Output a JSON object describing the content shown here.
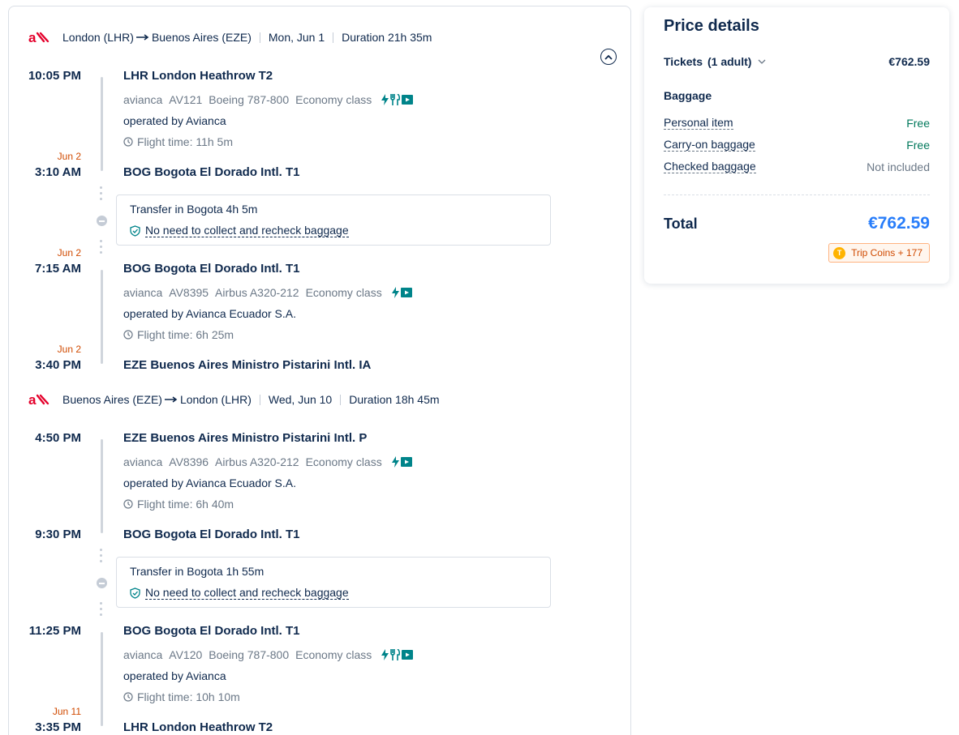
{
  "colors": {
    "accent": "#287dfa",
    "free": "#00785b",
    "date_note": "#d04a00",
    "amenity": "#00848a",
    "airline": "#e4002b"
  },
  "legs": [
    {
      "route_from": "London (LHR)",
      "route_to": "Buenos Aires (EZE)",
      "date": "Mon, Jun 1",
      "duration": "Duration 21h 35m",
      "airline_logo": "avianca-logo"
    },
    {
      "route_from": "Buenos Aires (EZE)",
      "route_to": "London (LHR)",
      "date": "Wed, Jun 10",
      "duration": "Duration 18h 45m",
      "airline_logo": "avianca-logo"
    }
  ],
  "segments": [
    {
      "dep_time": "10:05 PM",
      "dep_airport": "LHR London Heathrow T2",
      "airline": "avianca",
      "flight_no": "AV121",
      "aircraft": "Boeing 787-800",
      "cabin": "Economy class",
      "amenities": [
        "power-icon",
        "meal-icon",
        "entertainment-icon"
      ],
      "operated_by": "operated by Avianca",
      "flight_time": "Flight time: 11h 5m",
      "arr_date_note": "Jun 2",
      "arr_time": "3:10 AM",
      "arr_airport": "BOG Bogota El Dorado Intl. T1"
    },
    {
      "dep_date_note": "Jun 2",
      "dep_time": "7:15 AM",
      "dep_airport": "BOG Bogota El Dorado Intl. T1",
      "airline": "avianca",
      "flight_no": "AV8395",
      "aircraft": "Airbus A320-212",
      "cabin": "Economy class",
      "amenities": [
        "power-icon",
        "entertainment-icon"
      ],
      "operated_by": "operated by Avianca Ecuador S.A.",
      "flight_time": "Flight time: 6h 25m",
      "arr_date_note": "Jun 2",
      "arr_time": "3:40 PM",
      "arr_airport": "EZE Buenos Aires Ministro Pistarini Intl. IA"
    },
    {
      "dep_time": "4:50 PM",
      "dep_airport": "EZE Buenos Aires Ministro Pistarini Intl. P",
      "airline": "avianca",
      "flight_no": "AV8396",
      "aircraft": "Airbus A320-212",
      "cabin": "Economy class",
      "amenities": [
        "power-icon",
        "entertainment-icon"
      ],
      "operated_by": "operated by Avianca Ecuador S.A.",
      "flight_time": "Flight time: 6h 40m",
      "arr_time": "9:30 PM",
      "arr_airport": "BOG Bogota El Dorado Intl. T1"
    },
    {
      "dep_time": "11:25 PM",
      "dep_airport": "BOG Bogota El Dorado Intl. T1",
      "airline": "avianca",
      "flight_no": "AV120",
      "aircraft": "Boeing 787-800",
      "cabin": "Economy class",
      "amenities": [
        "power-icon",
        "meal-icon",
        "entertainment-icon"
      ],
      "operated_by": "operated by Avianca",
      "flight_time": "Flight time: 10h 10m",
      "arr_date_note": "Jun 11",
      "arr_time": "3:35 PM",
      "arr_airport": "LHR London Heathrow T2"
    }
  ],
  "transfers": [
    {
      "title": "Transfer in Bogota  4h 5m",
      "note": "No need to collect and recheck baggage"
    },
    {
      "title": "Transfer in Bogota  1h 55m",
      "note": "No need to collect and recheck baggage"
    }
  ],
  "price_details": {
    "title": "Price details",
    "tickets_label": "Tickets",
    "tickets_count": "(1 adult)",
    "tickets_price": "€762.59",
    "baggage_heading": "Baggage",
    "baggage": [
      {
        "label": "Personal item",
        "value": "Free"
      },
      {
        "label": "Carry-on baggage",
        "value": "Free"
      },
      {
        "label": "Checked baggage",
        "value": "Not included"
      }
    ],
    "total_label": "Total",
    "total_value": "€762.59",
    "coins_label": "Trip Coins + 177",
    "coin_symbol": "T"
  }
}
